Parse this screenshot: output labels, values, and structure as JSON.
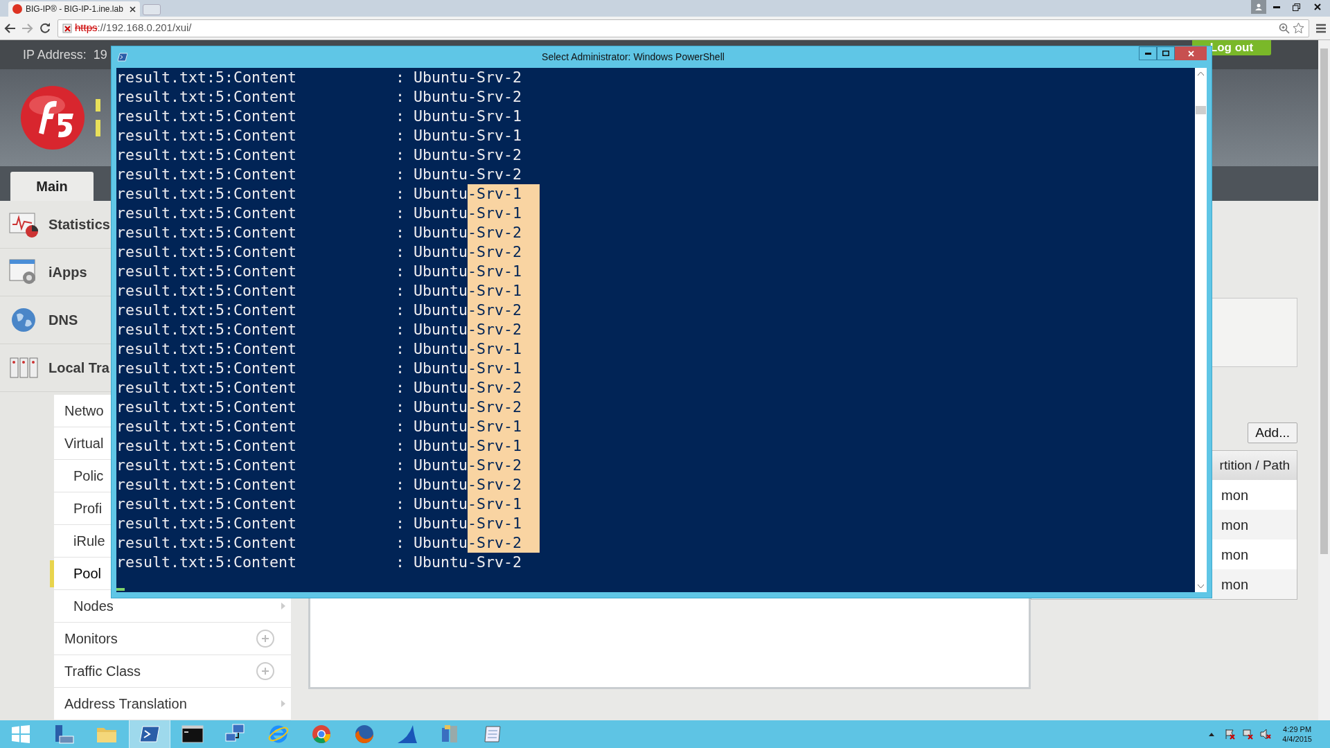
{
  "browser": {
    "tab_title": "BIG-IP® - BIG-IP-1.ine.lab",
    "url_scheme": "https",
    "url_rest": "://192.168.0.201/xui/"
  },
  "f5": {
    "ip_label": "IP Address:  19",
    "logout": "Log out",
    "tabs": [
      {
        "label": "Main",
        "selected": true
      }
    ],
    "nav": [
      {
        "label": "Statistics",
        "kind": "chart"
      },
      {
        "label": "iApps",
        "kind": "gear"
      },
      {
        "label": "DNS",
        "kind": "globe"
      },
      {
        "label": "Local Tra",
        "kind": "servers"
      }
    ],
    "submenu": [
      {
        "label": "Netwo",
        "kind": "plain",
        "selected": false
      },
      {
        "label": "Virtual",
        "kind": "plain",
        "selected": false,
        "children": [
          {
            "label": "Polic",
            "kind": "plain",
            "selected": false
          },
          {
            "label": "Profi",
            "kind": "plain",
            "selected": false
          },
          {
            "label": "iRule",
            "kind": "plain",
            "selected": false
          },
          {
            "label": "Pool",
            "kind": "plain",
            "selected": true
          },
          {
            "label": "Nodes",
            "kind": "arrow",
            "selected": false
          }
        ]
      },
      {
        "label": "Monitors",
        "kind": "plus",
        "selected": false
      },
      {
        "label": "Traffic Class",
        "kind": "plus",
        "selected": false
      },
      {
        "label": "Address Translation",
        "kind": "arrow",
        "selected": false
      }
    ],
    "add_button": "Add...",
    "table": {
      "columns": [
        "rtition / Path"
      ],
      "rows": [
        [
          "mon"
        ],
        [
          "mon"
        ],
        [
          "mon"
        ],
        [
          "mon"
        ]
      ]
    }
  },
  "powershell": {
    "title": "Select Administrator: Windows PowerShell",
    "lines": [
      {
        "text": "result.txt:5:Content           : Ubuntu-Srv-2",
        "selected": false
      },
      {
        "text": "result.txt:5:Content           : Ubuntu-Srv-2",
        "selected": false
      },
      {
        "text": "result.txt:5:Content           : Ubuntu-Srv-1",
        "selected": false
      },
      {
        "text": "result.txt:5:Content           : Ubuntu-Srv-1",
        "selected": false
      },
      {
        "text": "result.txt:5:Content           : Ubuntu-Srv-2",
        "selected": false
      },
      {
        "text": "result.txt:5:Content           : Ubuntu-Srv-2",
        "selected": false
      },
      {
        "text": "result.txt:5:Content           : Ubuntu-Srv-1",
        "selected": true
      },
      {
        "text": "result.txt:5:Content           : Ubuntu-Srv-1",
        "selected": true
      },
      {
        "text": "result.txt:5:Content           : Ubuntu-Srv-2",
        "selected": true
      },
      {
        "text": "result.txt:5:Content           : Ubuntu-Srv-2",
        "selected": true
      },
      {
        "text": "result.txt:5:Content           : Ubuntu-Srv-1",
        "selected": true
      },
      {
        "text": "result.txt:5:Content           : Ubuntu-Srv-1",
        "selected": true
      },
      {
        "text": "result.txt:5:Content           : Ubuntu-Srv-2",
        "selected": true
      },
      {
        "text": "result.txt:5:Content           : Ubuntu-Srv-2",
        "selected": true
      },
      {
        "text": "result.txt:5:Content           : Ubuntu-Srv-1",
        "selected": true
      },
      {
        "text": "result.txt:5:Content           : Ubuntu-Srv-1",
        "selected": true
      },
      {
        "text": "result.txt:5:Content           : Ubuntu-Srv-2",
        "selected": true
      },
      {
        "text": "result.txt:5:Content           : Ubuntu-Srv-2",
        "selected": true
      },
      {
        "text": "result.txt:5:Content           : Ubuntu-Srv-1",
        "selected": true
      },
      {
        "text": "result.txt:5:Content           : Ubuntu-Srv-1",
        "selected": true
      },
      {
        "text": "result.txt:5:Content           : Ubuntu-Srv-2",
        "selected": true
      },
      {
        "text": "result.txt:5:Content           : Ubuntu-Srv-2",
        "selected": true
      },
      {
        "text": "result.txt:5:Content           : Ubuntu-Srv-1",
        "selected": true
      },
      {
        "text": "result.txt:5:Content           : Ubuntu-Srv-1",
        "selected": true
      },
      {
        "text": "result.txt:5:Content           : Ubuntu-Srv-2",
        "selected": true
      },
      {
        "text": "result.txt:5:Content           : Ubuntu-Srv-2",
        "selected": false
      }
    ]
  },
  "taskbar": {
    "items": [
      {
        "kind": "start",
        "selected": false
      },
      {
        "kind": "server-manager",
        "selected": false
      },
      {
        "kind": "folder",
        "selected": false
      },
      {
        "kind": "powershell",
        "selected": true
      },
      {
        "kind": "cmd",
        "selected": false
      },
      {
        "kind": "network",
        "selected": false
      },
      {
        "kind": "ie",
        "selected": false
      },
      {
        "kind": "chrome",
        "selected": false
      },
      {
        "kind": "firefox",
        "selected": false
      },
      {
        "kind": "shark",
        "selected": false
      },
      {
        "kind": "tool",
        "selected": false
      },
      {
        "kind": "notepad",
        "selected": false
      }
    ],
    "time": "4:29 PM",
    "date": "4/4/2015"
  }
}
